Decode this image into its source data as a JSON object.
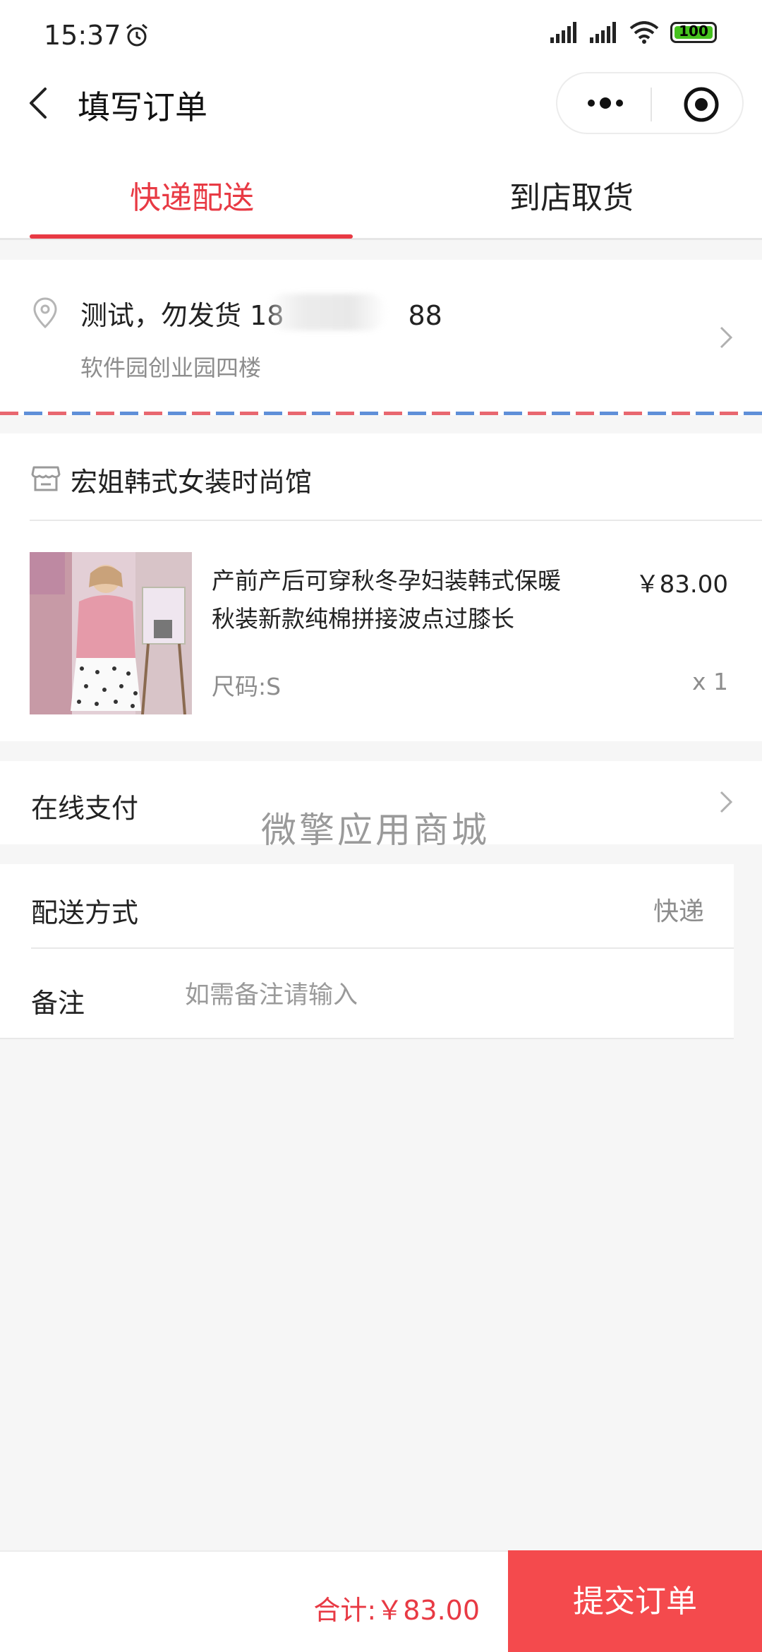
{
  "status_bar": {
    "time": "15:37",
    "battery": "100"
  },
  "nav": {
    "title": "填写订单"
  },
  "tabs": [
    {
      "label": "快递配送",
      "active": true
    },
    {
      "label": "到店取货",
      "active": false
    }
  ],
  "address": {
    "name_phone": "测试，勿发货 18",
    "phone_tail": "88",
    "detail": "软件园创业园四楼"
  },
  "shop": {
    "name": "宏姐韩式女装时尚馆"
  },
  "product": {
    "title": "产前产后可穿秋冬孕妇装韩式保暖秋装新款纯棉拼接波点过膝长",
    "price": "￥83.00",
    "sku": "尺码:S",
    "qty": "x 1"
  },
  "payment": {
    "label": "在线支付"
  },
  "watermark": "微擎应用商城",
  "shipping": {
    "label": "配送方式",
    "value": "快递"
  },
  "remark": {
    "label": "备注",
    "placeholder": "如需备注请输入"
  },
  "footer": {
    "total": "合计:￥83.00",
    "submit": "提交订单"
  },
  "colors": {
    "accent": "#e83a44",
    "submit_bg": "#f44a4d",
    "background": "#f6f6f6"
  }
}
